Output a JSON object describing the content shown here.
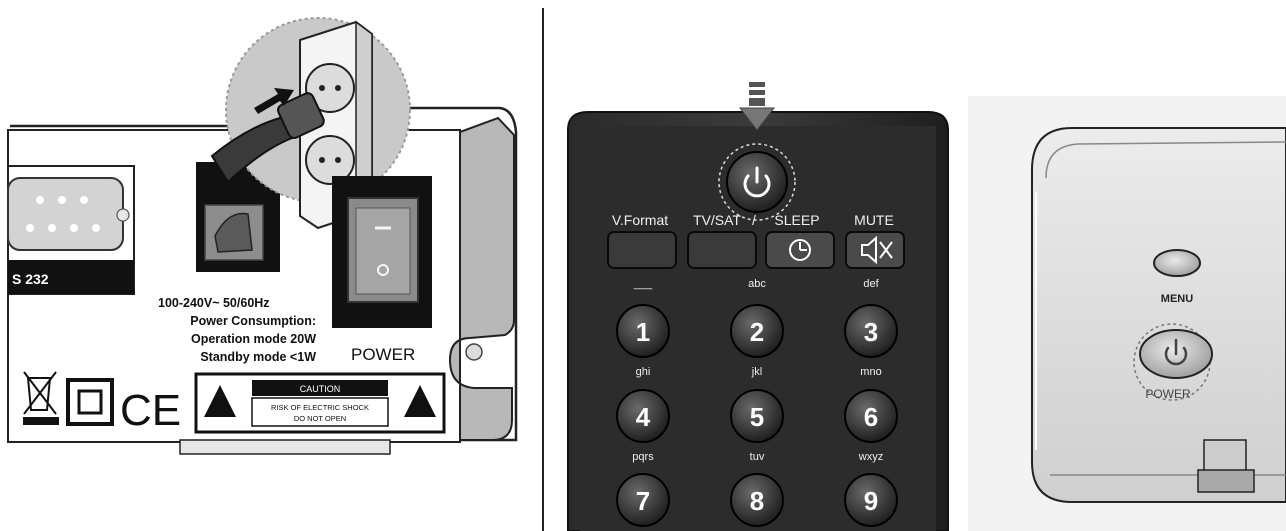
{
  "rear_panel": {
    "port_label": "S 232",
    "rating": "100-240V~  50/60Hz",
    "consumption_title": "Power Consumption:",
    "operation_mode": "Operation mode 20W",
    "standby_mode": "Standby mode <1W",
    "power_switch_label": "POWER",
    "caution_title": "CAUTION",
    "caution_line1": "RISK OF ELECTRIC SHOCK",
    "caution_line2": "DO NOT OPEN",
    "ce_mark": "CE"
  },
  "remote": {
    "row_labels": [
      "V.Format",
      "TV/SAT",
      "SLEEP",
      "MUTE"
    ],
    "keys": [
      {
        "digit": "1",
        "letters": "___"
      },
      {
        "digit": "2",
        "letters": "abc"
      },
      {
        "digit": "3",
        "letters": "def"
      },
      {
        "digit": "4",
        "letters": "ghi"
      },
      {
        "digit": "5",
        "letters": "jkl"
      },
      {
        "digit": "6",
        "letters": "mno"
      },
      {
        "digit": "7",
        "letters": "pqrs"
      },
      {
        "digit": "8",
        "letters": "tuv"
      },
      {
        "digit": "9",
        "letters": "wxyz"
      }
    ]
  },
  "front_panel": {
    "menu_label": "MENU",
    "power_label": "POWER"
  },
  "icons": {
    "power": "power-icon",
    "clock": "clock-icon",
    "mute": "speaker-mute-icon",
    "arrow": "arrow-down-icon",
    "weee": "crossed-bin-icon",
    "double_insulation": "double-square-icon",
    "warning": "warning-triangle-icon"
  }
}
